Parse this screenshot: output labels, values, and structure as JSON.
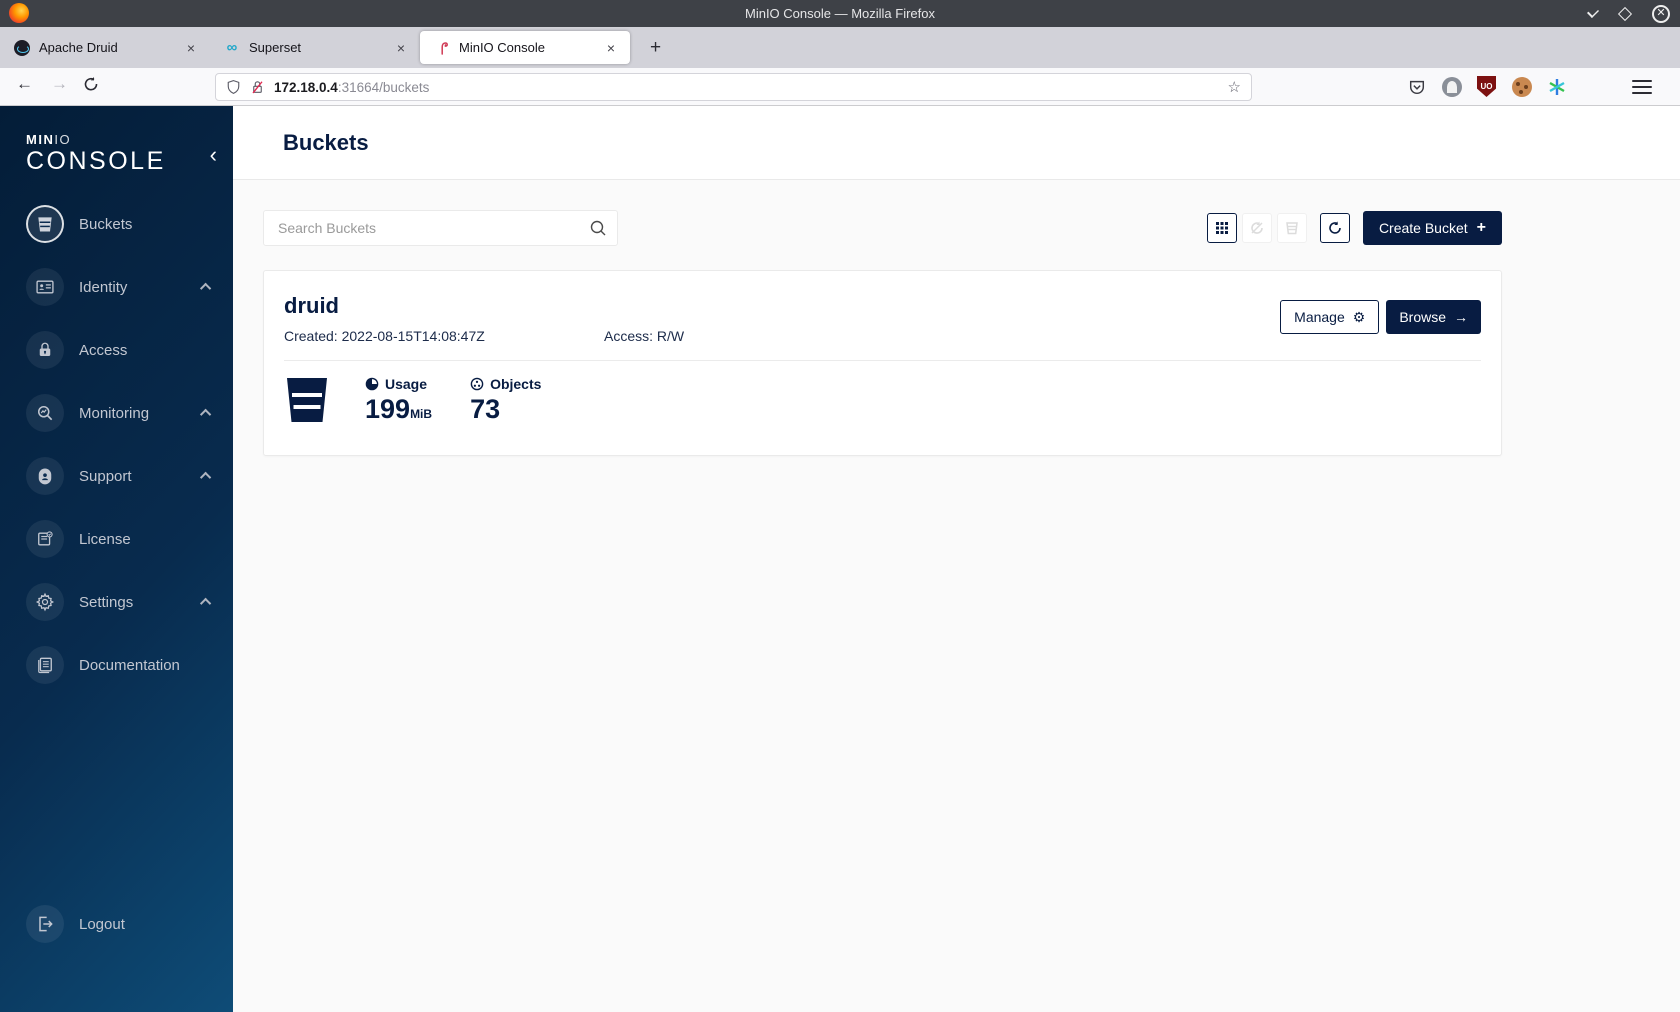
{
  "titlebar": {
    "title": "MinIO Console — Mozilla Firefox"
  },
  "tabs": [
    {
      "label": "Apache Druid",
      "favicon": "druid-icon"
    },
    {
      "label": "Superset",
      "favicon": "superset-icon"
    },
    {
      "label": "MinIO Console",
      "favicon": "minio-flamingo-icon",
      "active": true
    }
  ],
  "icons": {
    "close_tab": "×",
    "new_tab": "+",
    "back": "←",
    "forward": "→",
    "bookmark_star": "☆",
    "collapse_sidebar": "‹",
    "superset_glyph": "∞",
    "ublock_text": "UO",
    "gear": "⚙",
    "browse_arrow": "→",
    "window_close": "✕"
  },
  "urlbar": {
    "host": "172.18.0.4",
    "path": ":31664/buckets"
  },
  "sidebar": {
    "logo_min": "MIN",
    "logo_io": "IO",
    "logo_console": "CONSOLE",
    "items": [
      {
        "label": "Buckets",
        "icon": "bucket-icon",
        "active": true,
        "expandable": false
      },
      {
        "label": "Identity",
        "icon": "identity-card-icon",
        "active": false,
        "expandable": true
      },
      {
        "label": "Access",
        "icon": "lock-icon",
        "active": false,
        "expandable": false
      },
      {
        "label": "Monitoring",
        "icon": "monitoring-magnifier-icon",
        "active": false,
        "expandable": true
      },
      {
        "label": "Support",
        "icon": "support-icon",
        "active": false,
        "expandable": true
      },
      {
        "label": "License",
        "icon": "license-document-icon",
        "active": false,
        "expandable": false
      },
      {
        "label": "Settings",
        "icon": "gear-icon",
        "active": false,
        "expandable": true
      },
      {
        "label": "Documentation",
        "icon": "documentation-book-icon",
        "active": false,
        "expandable": false
      }
    ],
    "logout_label": "Logout"
  },
  "page": {
    "title": "Buckets",
    "search_placeholder": "Search Buckets",
    "create_button_label": "Create Bucket",
    "bucket": {
      "name": "druid",
      "created_label": "Created: 2022-08-15T14:08:47Z",
      "access_label": "Access: R/W",
      "manage_label": "Manage",
      "browse_label": "Browse",
      "usage_label": "Usage",
      "usage_value": "199",
      "usage_unit": "MiB",
      "objects_label": "Objects",
      "objects_value": "73"
    }
  },
  "colors": {
    "accent_navy": "#081C42",
    "sidebar_gradient_start": "#041d38",
    "sidebar_gradient_end": "#0e4c77",
    "titlebar": "#3e4147",
    "tabbar": "#d2d2d9",
    "content_bg": "#fafafa",
    "ublock_red": "#7d1111"
  }
}
